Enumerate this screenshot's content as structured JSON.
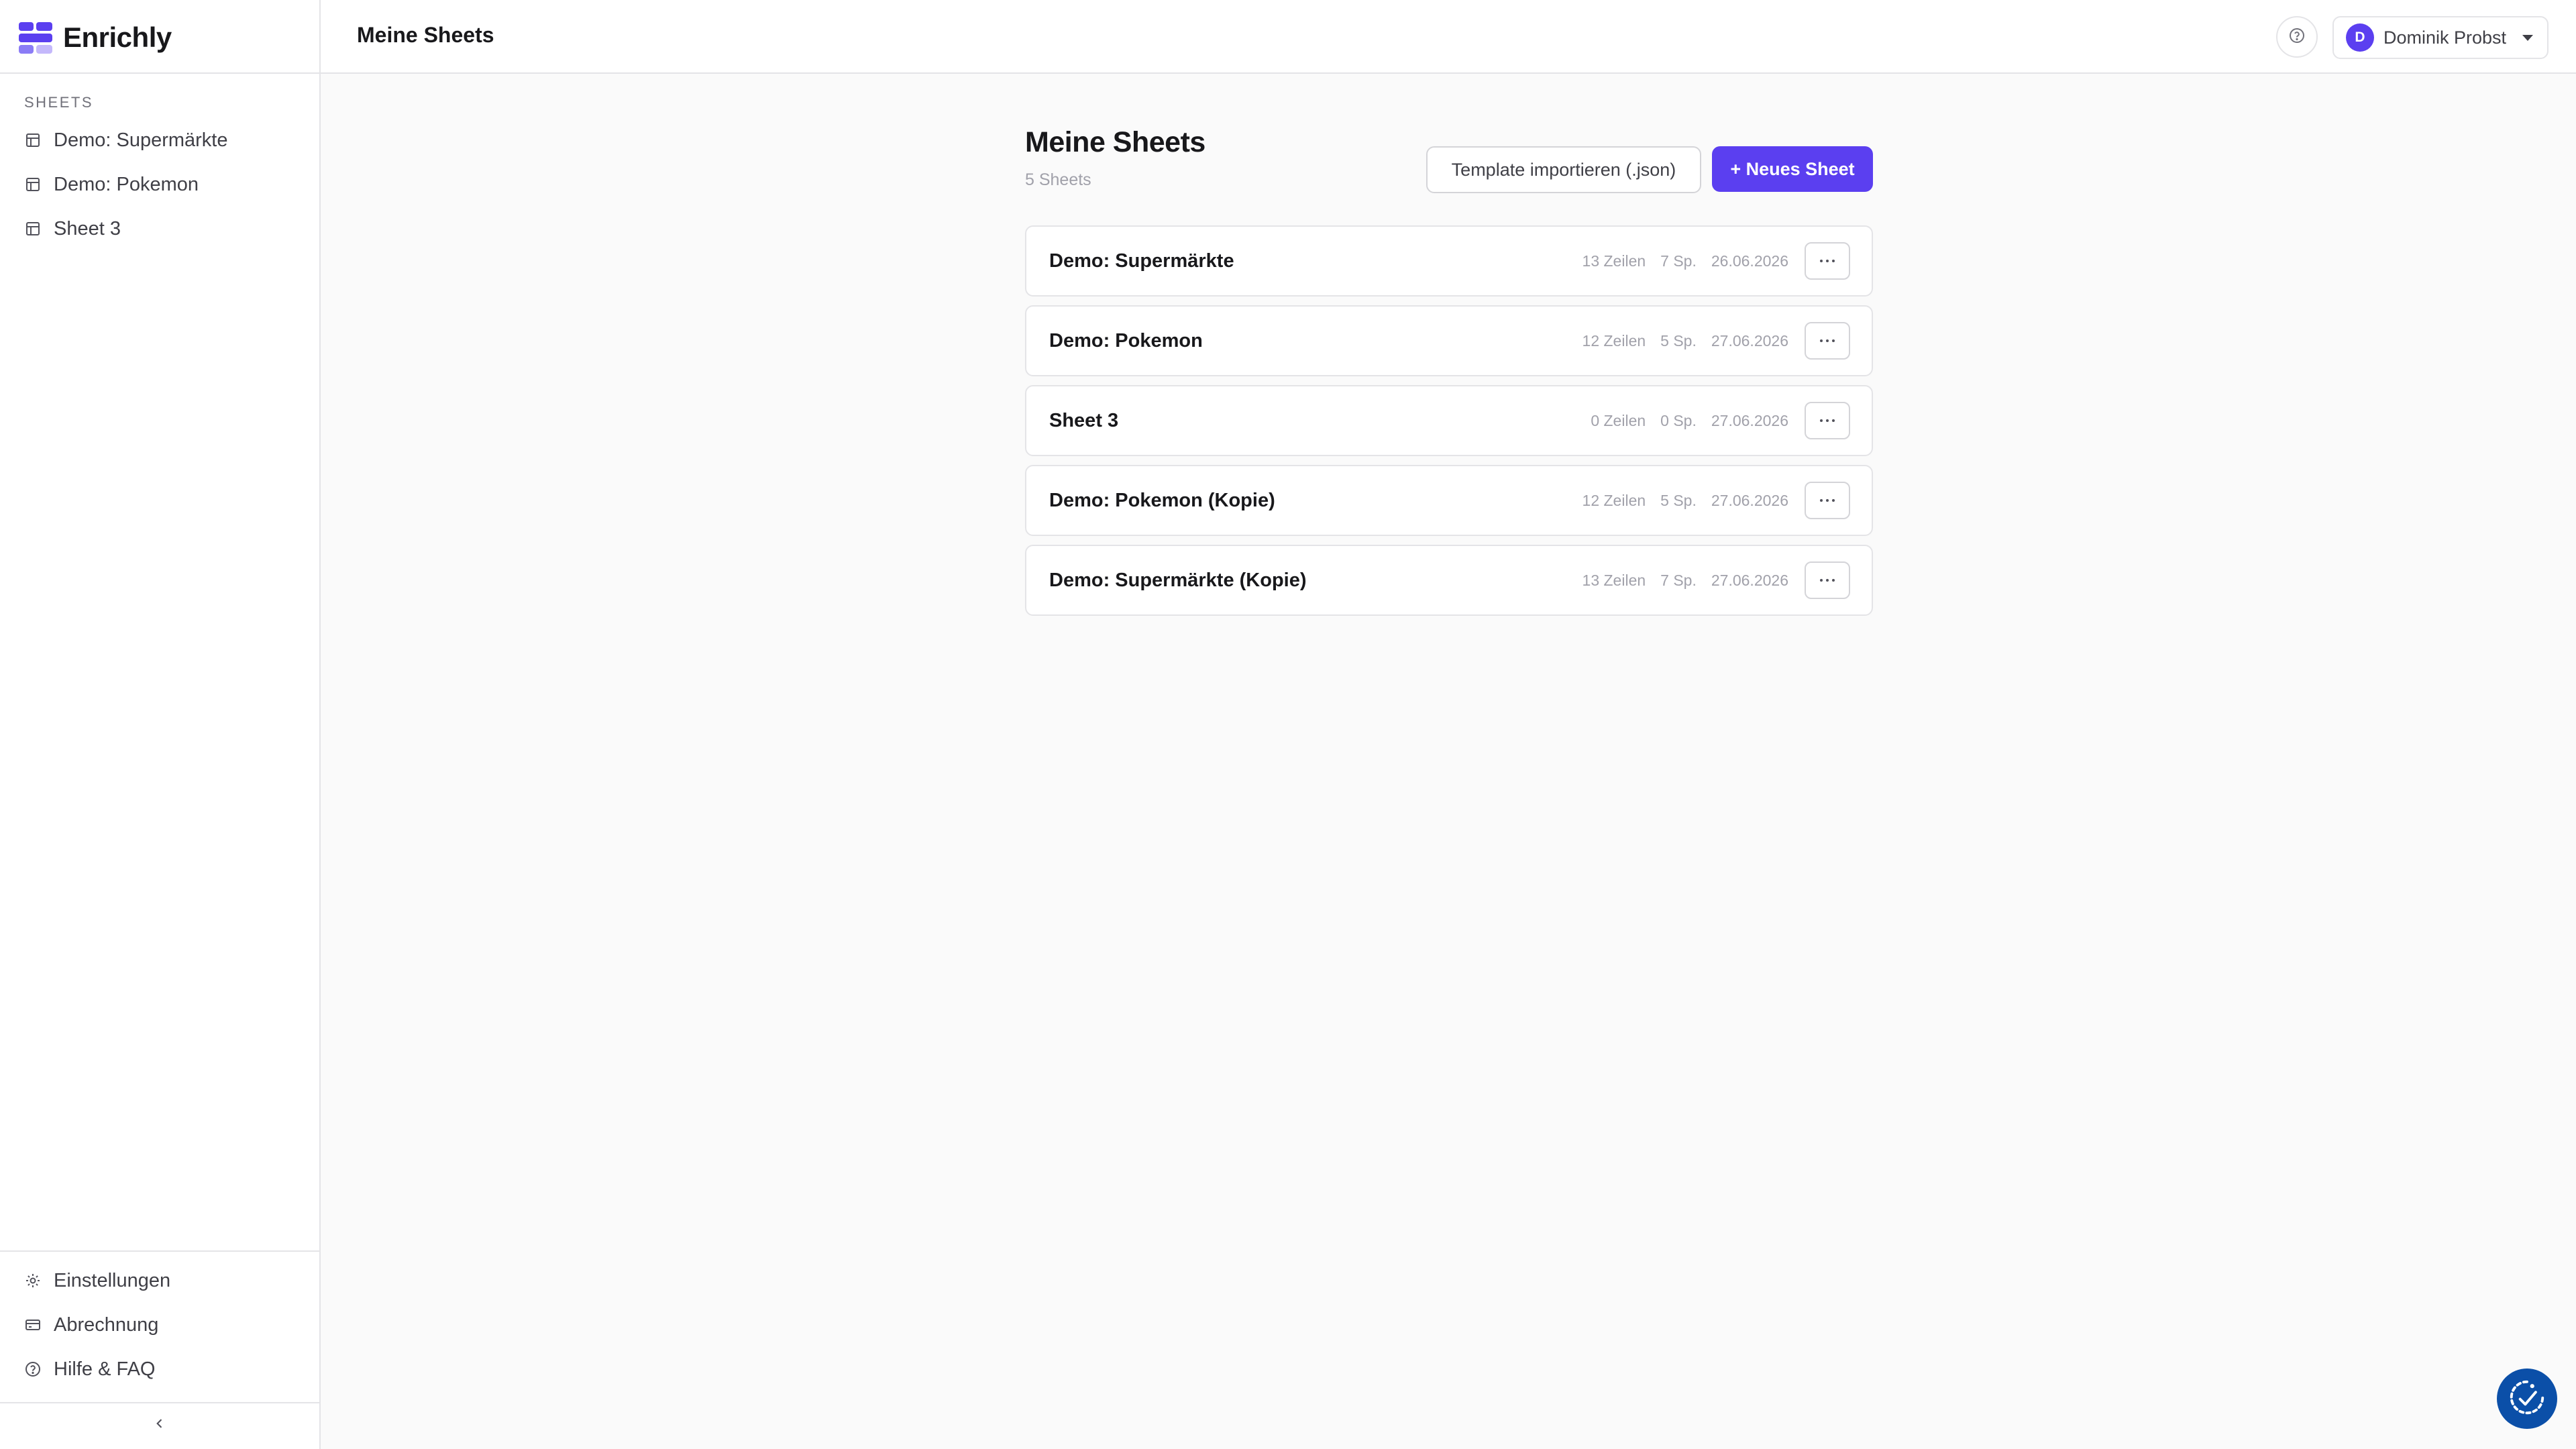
{
  "app": {
    "name": "Enrichly",
    "brand_color": "#5b3ff0",
    "logo_colors": [
      "#5b3ff0",
      "#8b7cf6",
      "#c4b8fb"
    ]
  },
  "sidebar": {
    "section_label": "SHEETS",
    "items": [
      {
        "label": "Demo: Supermärkte",
        "icon": "table-icon"
      },
      {
        "label": "Demo: Pokemon",
        "icon": "table-icon"
      },
      {
        "label": "Sheet 3",
        "icon": "table-icon"
      }
    ],
    "bottom_items": [
      {
        "label": "Einstellungen",
        "icon": "gear-icon"
      },
      {
        "label": "Abrechnung",
        "icon": "credit-card-icon"
      },
      {
        "label": "Hilfe & FAQ",
        "icon": "help-circle-icon"
      }
    ],
    "collapse_icon": "chevron-left-icon"
  },
  "header": {
    "title": "Meine Sheets",
    "help_icon": "help-circle-icon",
    "user": {
      "initial": "D",
      "name": "Dominik Probst"
    }
  },
  "main": {
    "title": "Meine Sheets",
    "subtitle": "5 Sheets",
    "import_button": "Template importieren (.json)",
    "new_button": "+ Neues Sheet",
    "sheets": [
      {
        "name": "Demo: Supermärkte",
        "rows": "13 Zeilen",
        "cols": "7 Sp.",
        "date": "26.06.2026"
      },
      {
        "name": "Demo: Pokemon",
        "rows": "12 Zeilen",
        "cols": "5 Sp.",
        "date": "27.06.2026"
      },
      {
        "name": "Sheet 3",
        "rows": "0 Zeilen",
        "cols": "0 Sp.",
        "date": "27.06.2026"
      },
      {
        "name": "Demo: Pokemon (Kopie)",
        "rows": "12 Zeilen",
        "cols": "5 Sp.",
        "date": "27.06.2026"
      },
      {
        "name": "Demo: Supermärkte (Kopie)",
        "rows": "13 Zeilen",
        "cols": "7 Sp.",
        "date": "27.06.2026"
      }
    ]
  },
  "widget": {
    "icon": "accessibility-check-icon",
    "color": "#0b4fa8"
  }
}
